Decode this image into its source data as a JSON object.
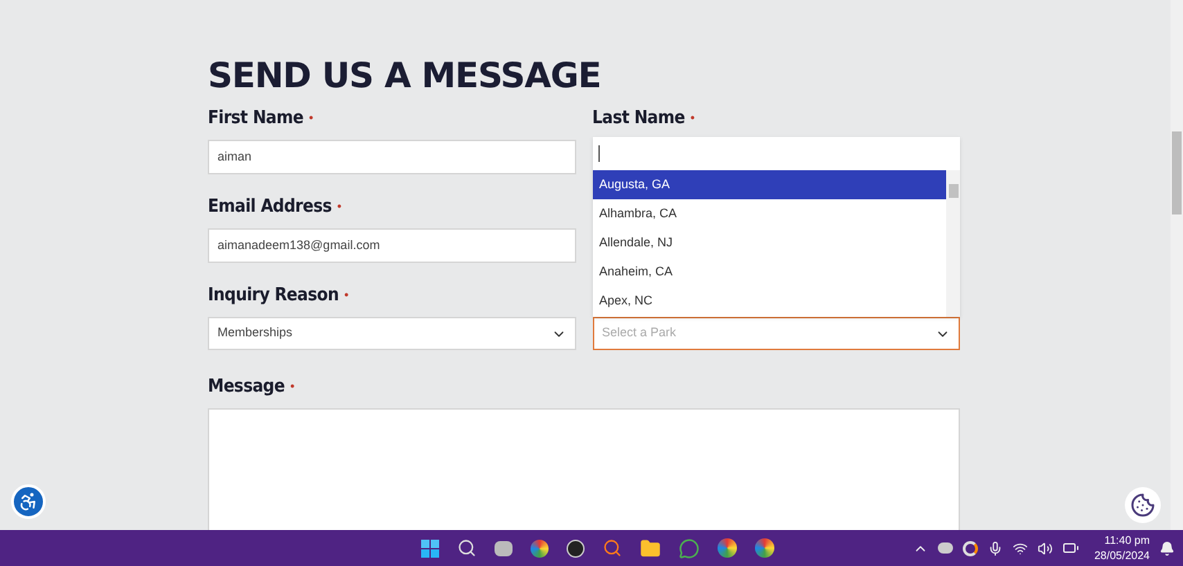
{
  "heading": "SEND US A MESSAGE",
  "fields": [
    {
      "label": "First Name",
      "required_mark": "•",
      "value": "aiman"
    },
    {
      "label": "Email Address",
      "required_mark": "•",
      "value": "aimanadeem138@gmail.com"
    }
  ],
  "last_name": {
    "label": "Last Name",
    "required_mark": "•"
  },
  "inquiry": {
    "label": "Inquiry Reason",
    "required_mark": "•",
    "value": "Memberships"
  },
  "park_select": {
    "placeholder": "Select a Park",
    "focused": true,
    "expanded": true,
    "options": [
      {
        "label": "Augusta, GA",
        "selected": true
      },
      {
        "label": "Alhambra, CA",
        "selected": false
      },
      {
        "label": "Allendale, NJ",
        "selected": false
      },
      {
        "label": "Anaheim, CA",
        "selected": false
      },
      {
        "label": "Apex, NC",
        "selected": false
      }
    ]
  },
  "message": {
    "label": "Message",
    "required_mark": "•"
  },
  "taskbar": {
    "time": "11:40 pm",
    "date": "28/05/2024"
  }
}
